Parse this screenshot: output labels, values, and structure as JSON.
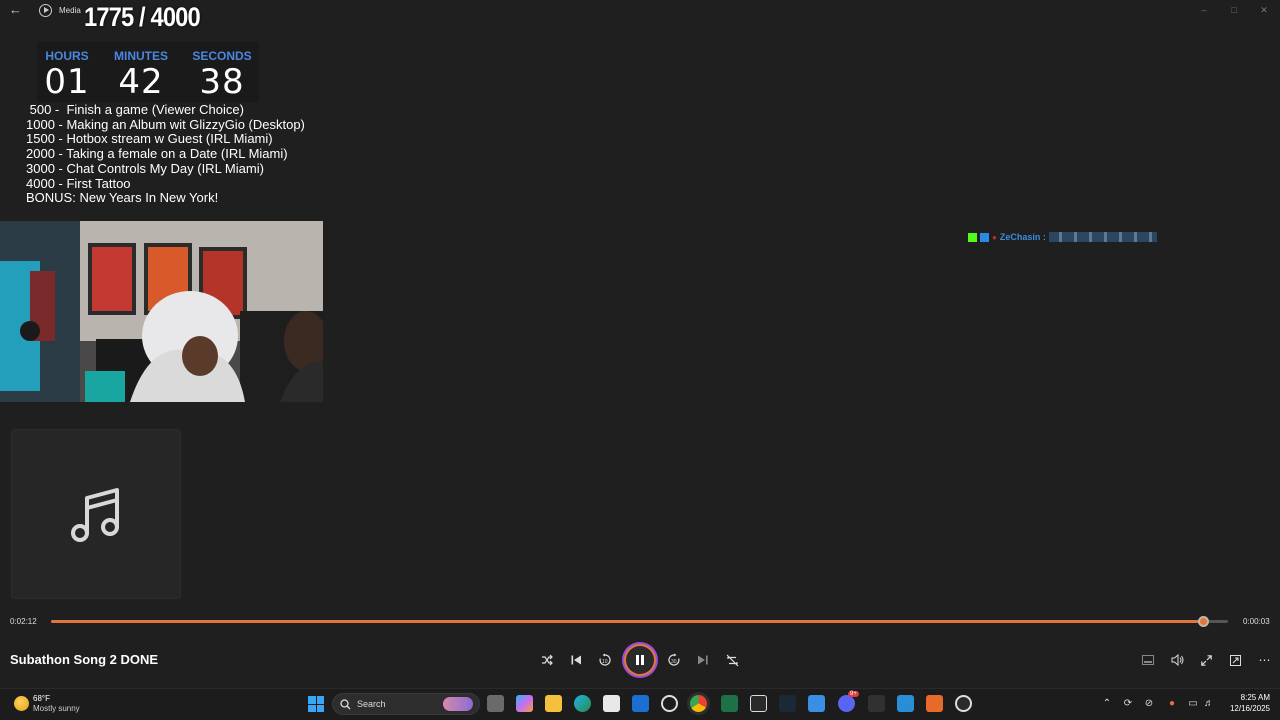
{
  "window": {
    "title": "Media"
  },
  "overlay": {
    "counter": "1775 / 4000",
    "timer": {
      "hours_label": "HOURS",
      "hours": "01",
      "minutes_label": "MINUTES",
      "minutes": "42",
      "seconds_label": "SECONDS",
      "seconds": "38"
    },
    "goals": [
      " 500 -  Finish a game (Viewer Choice)",
      "1000 - Making an Album wit GlizzyGio (Desktop)",
      "1500 - Hotbox stream w Guest (IRL Miami)",
      "2000 - Taking a female on a Date (IRL Miami)",
      "3000 - Chat Controls My Day (IRL Miami)",
      "4000 - First Tattoo",
      "BONUS: New Years In New York!"
    ],
    "chat": {
      "user": "ZeChasin :"
    }
  },
  "player": {
    "elapsed": "0:02:12",
    "remaining": "0:00:03",
    "progress": 0.98,
    "song_title": "Subathon Song 2 DONE"
  },
  "taskbar": {
    "temperature": "68°F",
    "condition": "Mostly sunny",
    "search_label": "Search",
    "time": "8:25 AM",
    "date": "12/16/2025",
    "discord_badge": "9+"
  },
  "colors": {
    "accent": "#e0753f",
    "timer_label": "#4a87e0",
    "background": "#1f1f1f"
  }
}
